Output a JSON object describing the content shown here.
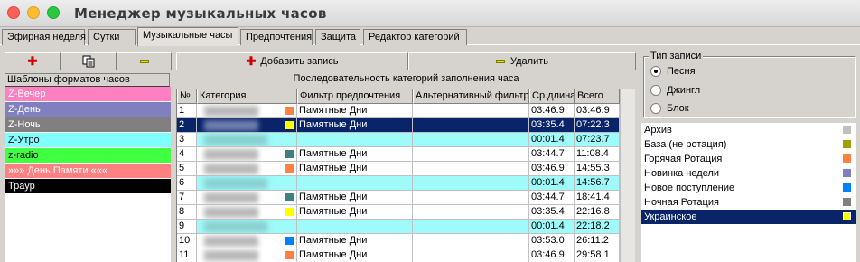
{
  "window": {
    "title": "Менеджер музыкальных часов"
  },
  "tabs": [
    {
      "label": "Эфирная неделя"
    },
    {
      "label": "Сутки"
    },
    {
      "label": "Музыкальные часы"
    },
    {
      "label": "Предпочтения"
    },
    {
      "label": "Защита"
    },
    {
      "label": "Редактор категорий"
    }
  ],
  "left": {
    "header": "Шаблоны форматов часов",
    "templates": [
      {
        "label": "Z-Вечер",
        "color": "#ff80c0"
      },
      {
        "label": "Z-День",
        "color": "#8080c0"
      },
      {
        "label": "Z-Ночь",
        "color": "#808080"
      },
      {
        "label": "Z-Утро",
        "color": "#80ffff"
      },
      {
        "label": "z-radio",
        "color": "#40ff40"
      },
      {
        "label": "»»» День Памяти «««",
        "color": "#ff8080"
      },
      {
        "label": "Траур",
        "color": "#000000"
      }
    ]
  },
  "center": {
    "add_label": "Добавить запись",
    "delete_label": "Удалить",
    "caption": "Последовательность категорий заполнения часа",
    "columns": [
      "№",
      "Категория",
      "Фильтр предпочтения",
      "Альтернативный фильтр",
      "Ср.длина",
      "Всего"
    ],
    "rows": [
      {
        "n": "1",
        "color": "#ff8040",
        "filter": "Памятные Дни",
        "avg": "03:46.9",
        "total": "03:46.9",
        "kind": "song"
      },
      {
        "n": "2",
        "color": "#ffff00",
        "filter": "Памятные Дни",
        "avg": "03:35.4",
        "total": "07:22.3",
        "kind": "selected"
      },
      {
        "n": "3",
        "color": "",
        "filter": "",
        "avg": "00:01.4",
        "total": "07:23.7",
        "kind": "jingle"
      },
      {
        "n": "4",
        "color": "#408080",
        "filter": "Памятные Дни",
        "avg": "03:44.7",
        "total": "11:08.4",
        "kind": "song"
      },
      {
        "n": "5",
        "color": "#ff8040",
        "filter": "Памятные Дни",
        "avg": "03:46.9",
        "total": "14:55.3",
        "kind": "song"
      },
      {
        "n": "6",
        "color": "",
        "filter": "",
        "avg": "00:01.4",
        "total": "14:56.7",
        "kind": "jingle"
      },
      {
        "n": "7",
        "color": "#408080",
        "filter": "Памятные Дни",
        "avg": "03:44.7",
        "total": "18:41.4",
        "kind": "song"
      },
      {
        "n": "8",
        "color": "#ffff00",
        "filter": "Памятные Дни",
        "avg": "03:35.4",
        "total": "22:16.8",
        "kind": "song"
      },
      {
        "n": "9",
        "color": "",
        "filter": "",
        "avg": "00:01.4",
        "total": "22:18.2",
        "kind": "jingle"
      },
      {
        "n": "10",
        "color": "#0080ff",
        "filter": "Памятные Дни",
        "avg": "03:53.0",
        "total": "26:11.2",
        "kind": "song"
      },
      {
        "n": "11",
        "color": "#ff8040",
        "filter": "Памятные Дни",
        "avg": "03:46.9",
        "total": "29:58.1",
        "kind": "song"
      }
    ]
  },
  "right": {
    "group_label": "Тип записи",
    "radios": [
      {
        "label": "Песня",
        "checked": true
      },
      {
        "label": "Джингл",
        "checked": false
      },
      {
        "label": "Блок",
        "checked": false
      }
    ],
    "categories": [
      {
        "label": "Архив",
        "color": "#c0c0c0"
      },
      {
        "label": "База (не ротация)",
        "color": "#a0a000"
      },
      {
        "label": "Горячая Ротация",
        "color": "#ff8040"
      },
      {
        "label": "Новинка недели",
        "color": "#8080c0"
      },
      {
        "label": "Новое поступление",
        "color": "#0080ff"
      },
      {
        "label": "Ночная Ротация",
        "color": "#808080"
      },
      {
        "label": "Украинское",
        "color": "#ffff00",
        "selected": true
      }
    ]
  }
}
